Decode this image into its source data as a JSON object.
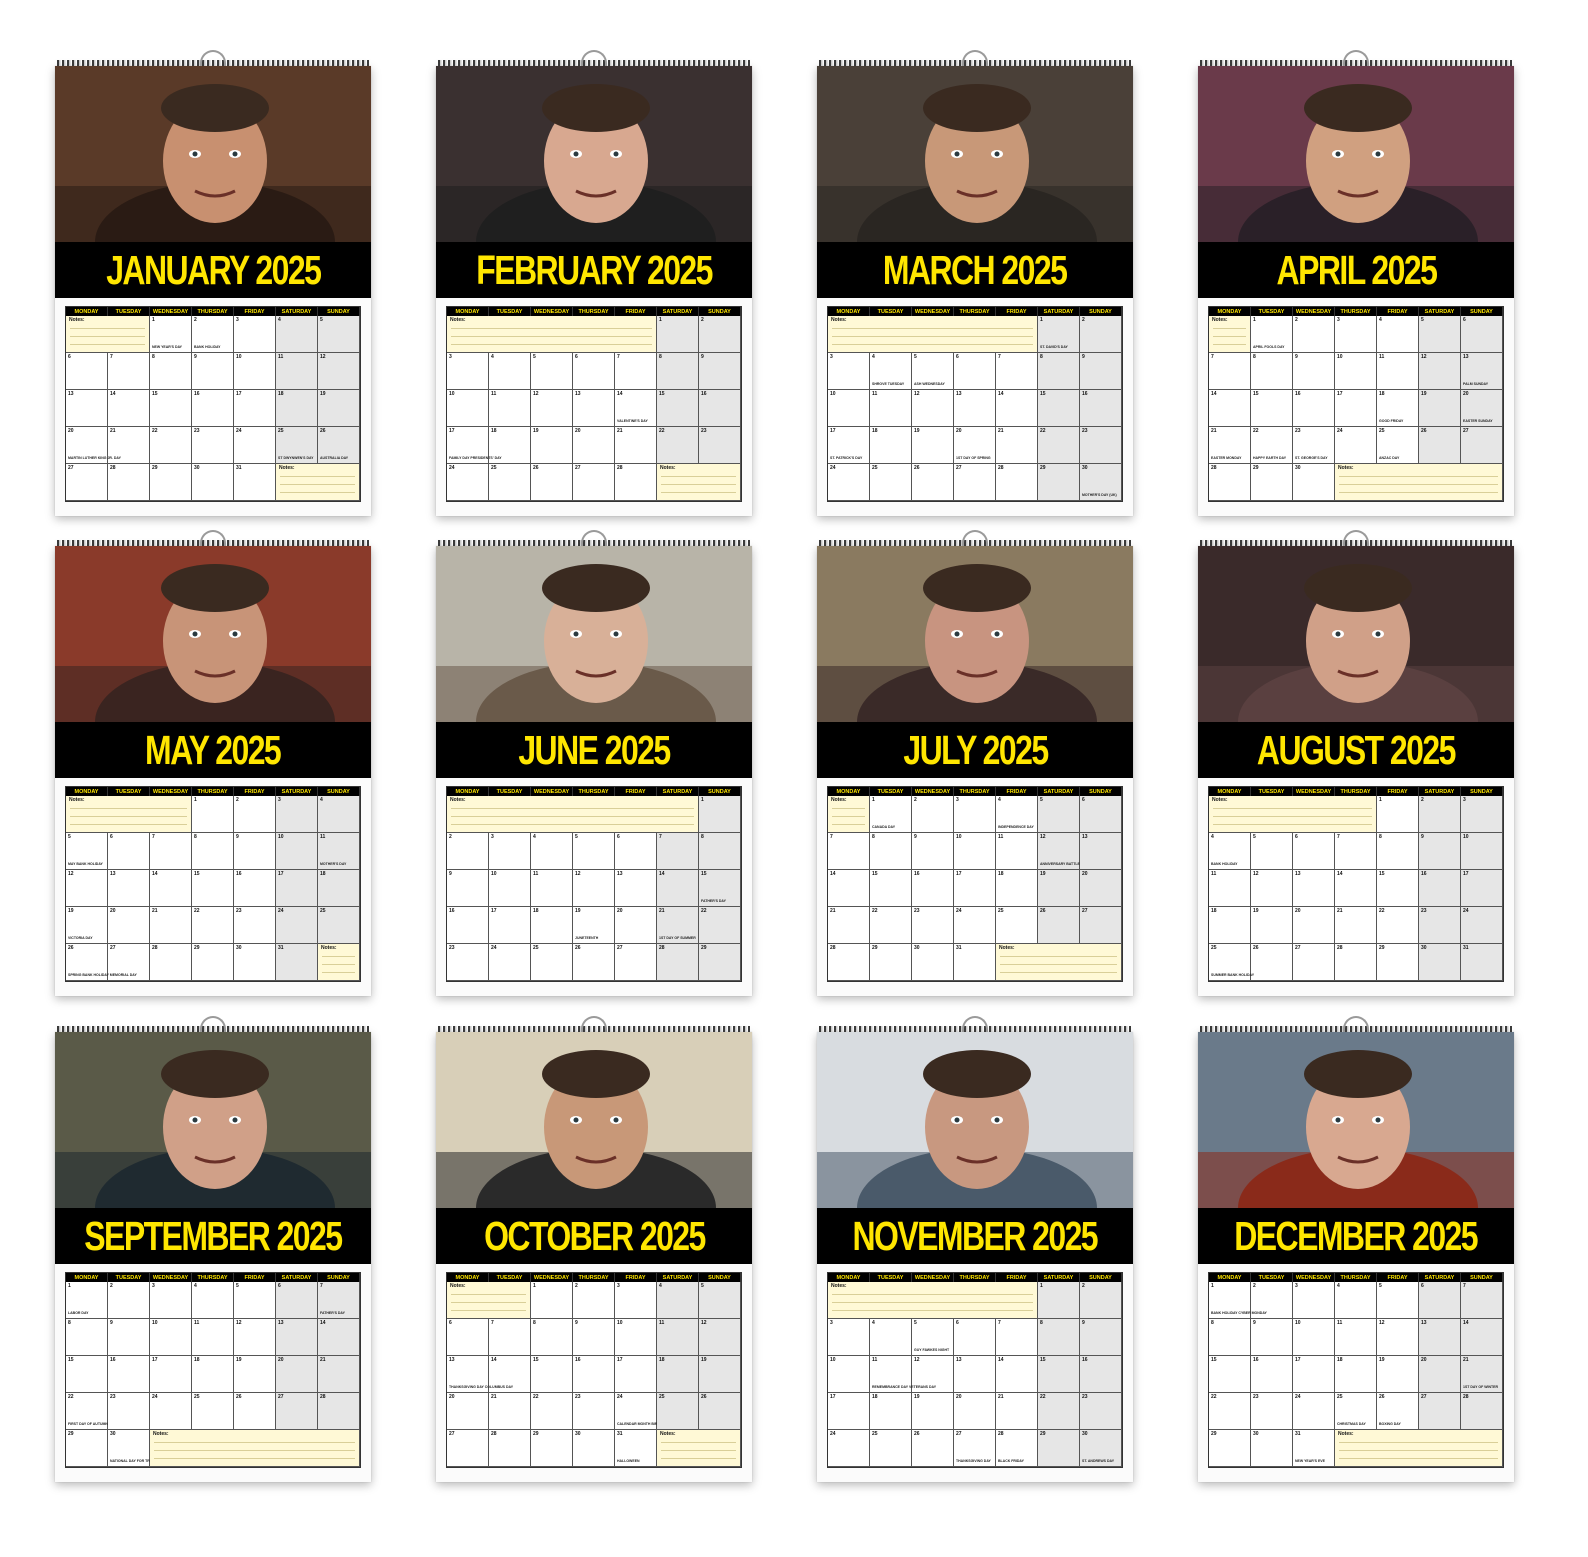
{
  "day_headers": [
    "MONDAY",
    "TUESDAY",
    "WEDNESDAY",
    "THURSDAY",
    "FRIDAY",
    "SATURDAY",
    "SUNDAY"
  ],
  "notes_label": "Notes:",
  "months": [
    {
      "title": "JANUARY 2025",
      "offset": 2,
      "days": 31,
      "trail": "sat",
      "events": {
        "1": "NEW YEAR'S DAY",
        "2": "BANK HOLIDAY",
        "20": "MARTIN LUTHER KING JR. DAY",
        "25": "ST DWYNWEN'S DAY",
        "26": "AUSTRALIA DAY"
      }
    },
    {
      "title": "FEBRUARY 2025",
      "offset": 5,
      "days": 28,
      "trail": "fri",
      "events": {
        "14": "VALENTINE'S DAY",
        "17": "FAMILY DAY PRESIDENTS' DAY"
      }
    },
    {
      "title": "MARCH 2025",
      "offset": 5,
      "days": 31,
      "trail": "tue",
      "events": {
        "1": "ST. DAVID'S DAY",
        "4": "SHROVE TUESDAY",
        "5": "ASH WEDNESDAY",
        "17": "ST. PATRICK'S DAY",
        "20": "1ST DAY OF SPRING",
        "30": "MOTHER'S DAY (UK)"
      }
    },
    {
      "title": "APRIL 2025",
      "offset": 1,
      "days": 30,
      "trail": "fri",
      "events": {
        "1": "APRIL FOOLS DAY",
        "13": "PALM SUNDAY",
        "18": "GOOD FRIDAY",
        "20": "EASTER SUNDAY",
        "21": "EASTER MONDAY",
        "22": "HAPPY EARTH DAY",
        "23": "ST. GEORGE'S DAY",
        "25": "ANZAC DAY"
      }
    },
    {
      "title": "MAY 2025",
      "offset": 3,
      "days": 31,
      "trail": "sat",
      "events": {
        "5": "MAY BANK HOLIDAY",
        "11": "MOTHER'S DAY",
        "19": "VICTORIA DAY",
        "26": "SPRING BANK HOLIDAY MEMORIAL DAY"
      }
    },
    {
      "title": "JUNE 2025",
      "offset": 6,
      "days": 30,
      "trail": "tue",
      "events": {
        "15": "FATHER'S DAY",
        "19": "JUNETEENTH",
        "21": "1ST DAY OF SUMMER"
      }
    },
    {
      "title": "JULY 2025",
      "offset": 1,
      "days": 31,
      "trail": "fri",
      "events": {
        "1": "CANADA DAY",
        "4": "INDEPENDENCE DAY",
        "12": "ANNIVERSARY BATTLE OF THE BOYNE"
      }
    },
    {
      "title": "AUGUST 2025",
      "offset": 4,
      "days": 31,
      "trail": "none",
      "events": {
        "4": "BANK HOLIDAY",
        "25": "SUMMER BANK HOLIDAY"
      }
    },
    {
      "title": "SEPTEMBER 2025",
      "offset": 0,
      "days": 30,
      "trail": "wed",
      "events": {
        "1": "LABOR DAY",
        "7": "FATHER'S DAY",
        "22": "FIRST DAY OF AUTUMN",
        "30": "NATIONAL DAY FOR TRUTH AND RECONCILIATION"
      }
    },
    {
      "title": "OCTOBER 2025",
      "offset": 2,
      "days": 31,
      "trail": "sat",
      "events": {
        "13": "THANKSGIVING DAY COLUMBUS DAY",
        "24": "CALENDAR MONTH BIRTHDAY",
        "31": "HALLOWEEN"
      }
    },
    {
      "title": "NOVEMBER 2025",
      "offset": 5,
      "days": 30,
      "trail": "none",
      "events": {
        "5": "GUY FAWKES NIGHT",
        "11": "REMEMBRANCE DAY VETERANS DAY",
        "27": "THANKSGIVING DAY",
        "28": "BLACK FRIDAY",
        "30": "ST. ANDREWS DAY"
      }
    },
    {
      "title": "DECEMBER 2025",
      "offset": 0,
      "days": 31,
      "trail": "thu",
      "events": {
        "1": "BANK HOLIDAY CYBER MONDAY",
        "21": "1ST DAY OF WINTER",
        "25": "CHRISTMAS DAY",
        "26": "BOXING DAY",
        "31": "NEW YEAR'S EVE"
      }
    }
  ],
  "colors": {
    "banner_bg": "#000000",
    "banner_text": "#ffe600",
    "notes_bg": "#fff9d6",
    "weekend_bg": "#e6e6e6"
  }
}
